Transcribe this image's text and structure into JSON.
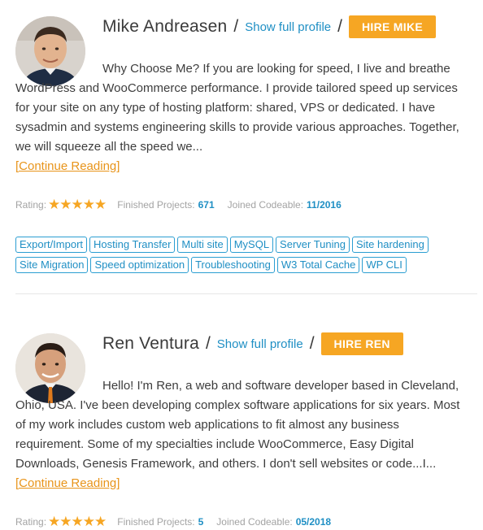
{
  "experts": [
    {
      "name": "Mike Andreasen",
      "separator": "/",
      "profile_link": "Show full profile",
      "hire_label": "HIRE MIKE",
      "bio": "Why Choose Me? If you are looking for speed, I live and breathe WordPress and WooCommerce performance. I provide tailored speed up services for your site on any type of hosting platform: shared, VPS or dedicated. I have sysadmin and systems engineering skills to provide various approaches. Together, we will squeeze all the speed we...",
      "read_more": "[Continue Reading]",
      "rating_label": "Rating:",
      "rating_stars": "★★★★★",
      "rating_value": 5,
      "projects_label": "Finished Projects:",
      "projects_value": "671",
      "joined_label": "Joined Codeable:",
      "joined_value": "11/2016",
      "skills": [
        "Export/Import",
        "Hosting Transfer",
        "Multi site",
        "MySQL",
        "Server Tuning",
        "Site hardening",
        "Site Migration",
        "Speed optimization",
        "Troubleshooting",
        "W3 Total Cache",
        "WP CLI"
      ]
    },
    {
      "name": "Ren Ventura",
      "separator": "/",
      "profile_link": "Show full profile",
      "hire_label": "HIRE REN",
      "bio": "Hello! I'm Ren, a web and software developer based in Cleveland, Ohio, USA. I've been developing complex software applications for six years. Most of my work includes custom web applications to fit almost any business requirement. Some of my specialties include WooCommerce, Easy Digital Downloads, Genesis Framework, and others. I don't sell websites or code...I...",
      "read_more": "[Continue Reading]",
      "rating_label": "Rating:",
      "rating_stars": "★★★★★",
      "rating_value": 5,
      "projects_label": "Finished Projects:",
      "projects_value": "5",
      "joined_label": "Joined Codeable:",
      "joined_value": "05/2018"
    }
  ],
  "colors": {
    "accent_orange": "#f6a623",
    "link_blue": "#1f8fc4",
    "tag_border": "#2b9ed2",
    "muted_gray": "#a3a3a3"
  },
  "icons": {
    "avatar_1": "avatar-photo",
    "avatar_2": "avatar-photo",
    "star": "star-icon"
  }
}
